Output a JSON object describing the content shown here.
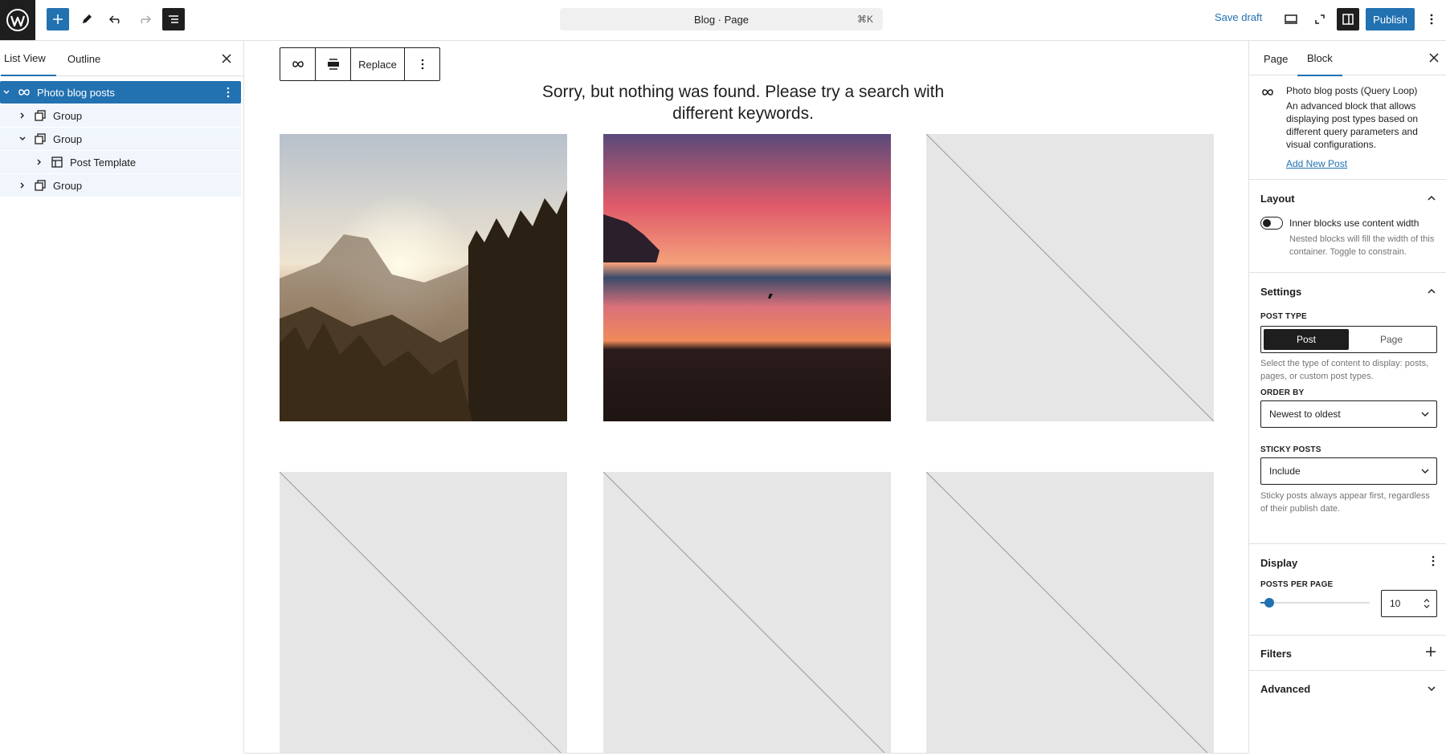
{
  "topbar": {
    "document_title": "Blog · Page",
    "shortcut": "⌘K",
    "save_draft": "Save draft",
    "publish": "Publish"
  },
  "left_panel": {
    "tabs": [
      "List View",
      "Outline"
    ],
    "tree": [
      {
        "label": "Photo blog posts",
        "level": 0,
        "expanded": true,
        "icon": "query-loop-icon",
        "selected": true
      },
      {
        "label": "Group",
        "level": 1,
        "expanded": false,
        "icon": "group-icon"
      },
      {
        "label": "Group",
        "level": 1,
        "expanded": true,
        "icon": "group-icon"
      },
      {
        "label": "Post Template",
        "level": 2,
        "expanded": false,
        "icon": "post-template-icon"
      },
      {
        "label": "Group",
        "level": 1,
        "expanded": false,
        "icon": "group-icon"
      }
    ]
  },
  "canvas": {
    "toolbar_replace": "Replace",
    "no_results": "Sorry, but nothing was found. Please try a search with different keywords.",
    "tiles": [
      {
        "type": "photo",
        "subject": "mountain sunset forest"
      },
      {
        "type": "photo",
        "subject": "beach sunset"
      },
      {
        "type": "placeholder"
      },
      {
        "type": "placeholder"
      },
      {
        "type": "placeholder"
      },
      {
        "type": "placeholder"
      }
    ]
  },
  "right_panel": {
    "tabs": [
      "Page",
      "Block"
    ],
    "block": {
      "title": "Photo blog posts (Query Loop)",
      "description": "An advanced block that allows displaying post types based on different query parameters and visual configurations.",
      "link": "Add New Post"
    },
    "layout": {
      "title": "Layout",
      "toggle_label": "Inner blocks use content width",
      "toggle_help": "Nested blocks will fill the width of this container. Toggle to constrain."
    },
    "settings": {
      "title": "Settings",
      "post_type_label": "POST TYPE",
      "post_type_options": [
        "Post",
        "Page"
      ],
      "post_type_help": "Select the type of content to display: posts, pages, or custom post types.",
      "order_by_label": "ORDER BY",
      "order_by_value": "Newest to oldest",
      "sticky_label": "STICKY POSTS",
      "sticky_value": "Include",
      "sticky_help": "Sticky posts always appear first, regardless of their publish date."
    },
    "display": {
      "title": "Display",
      "per_page_label": "POSTS PER PAGE",
      "per_page_value": "10"
    },
    "filters": {
      "title": "Filters"
    },
    "advanced": {
      "title": "Advanced"
    }
  },
  "colors": {
    "accent": "#2271b1",
    "dark": "#1e1e1e"
  }
}
